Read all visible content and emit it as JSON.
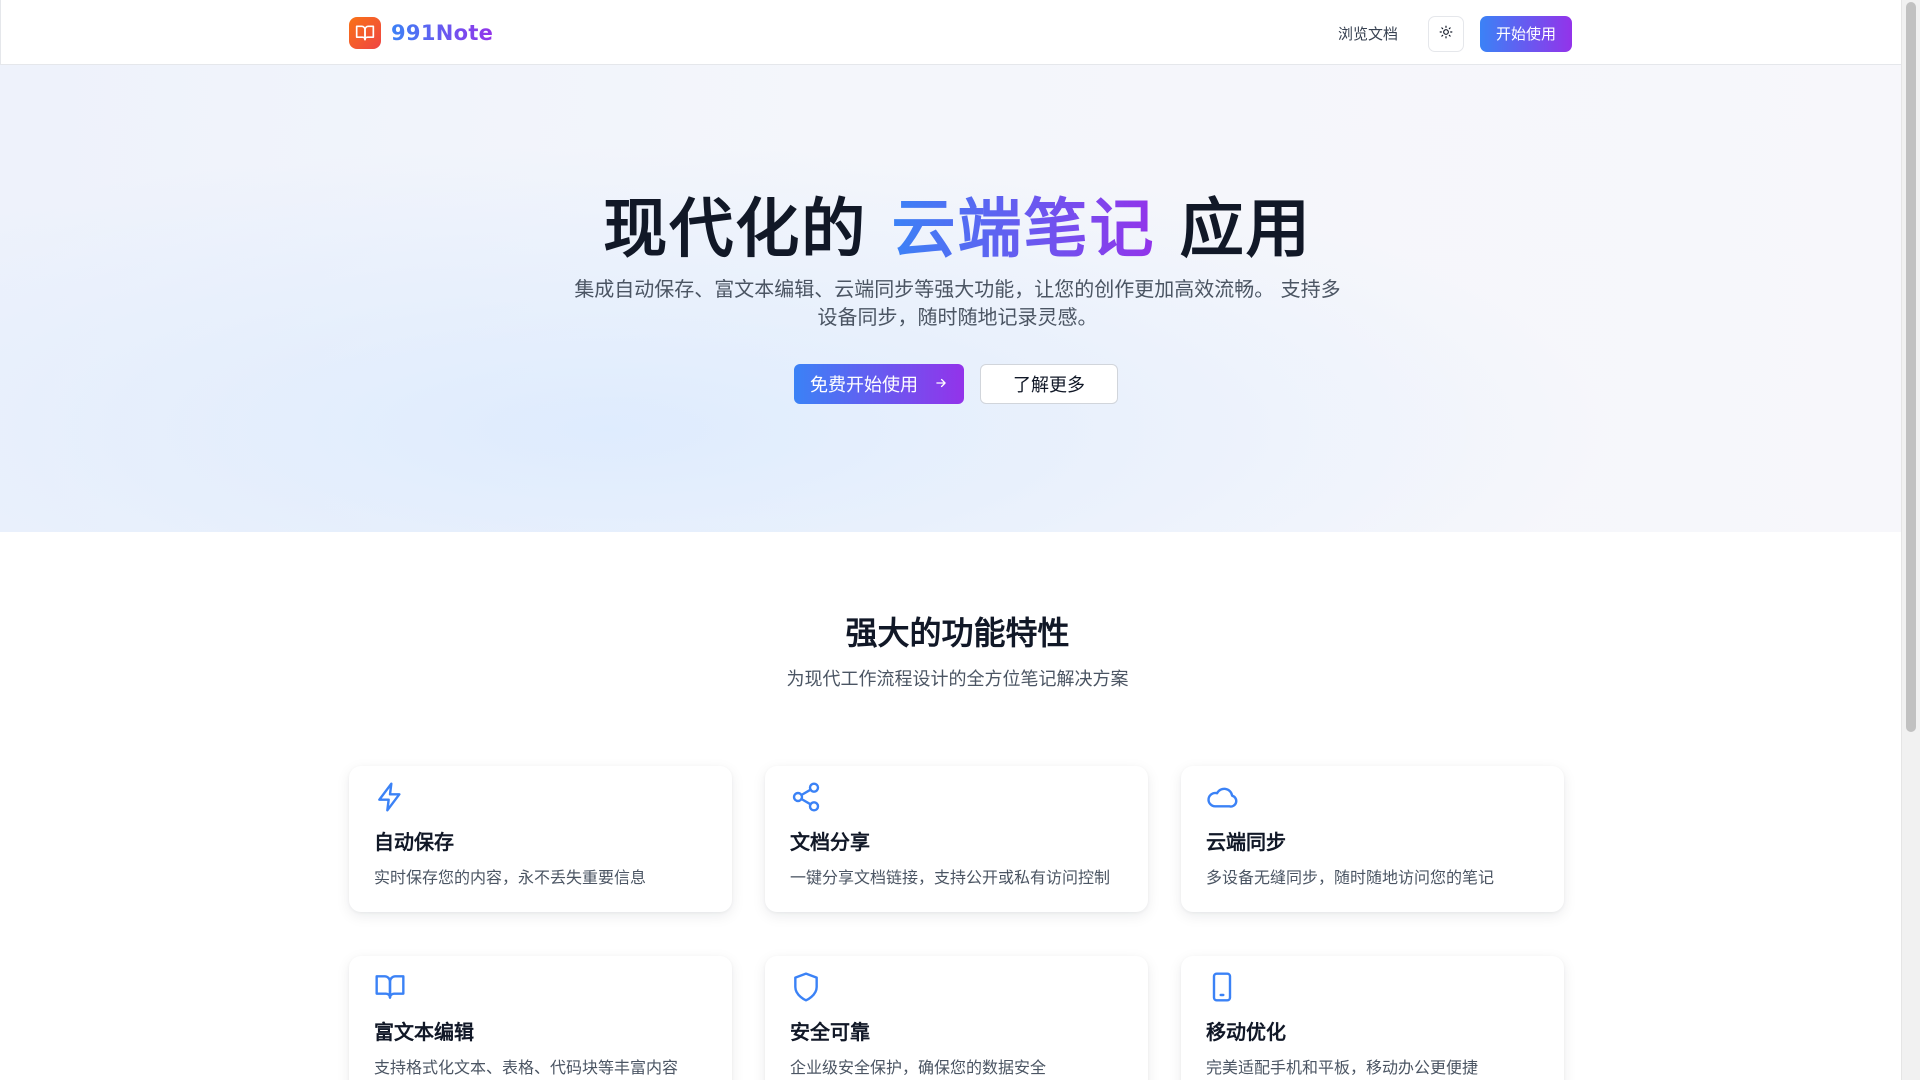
{
  "header": {
    "brand_name": "991Note",
    "logo_icon": "book-open-icon",
    "docs_link": "浏览文档",
    "theme_icon": "sun-icon",
    "start_label": "开始使用"
  },
  "hero": {
    "title_before": "现代化的",
    "title_highlight": "云端笔记",
    "title_after": "应用",
    "subtitle": "集成自动保存、富文本编辑、云端同步等强大功能，让您的创作更加高效流畅。 支持多设备同步，随时随地记录灵感。",
    "primary_button": "免费开始使用",
    "primary_button_icon": "arrow-right-icon",
    "secondary_button": "了解更多"
  },
  "features": {
    "title": "强大的功能特性",
    "subtitle": "为现代工作流程设计的全方位笔记解决方案",
    "items": [
      {
        "icon": "zap-icon",
        "title": "自动保存",
        "desc": "实时保存您的内容，永不丢失重要信息"
      },
      {
        "icon": "share-icon",
        "title": "文档分享",
        "desc": "一键分享文档链接，支持公开或私有访问控制"
      },
      {
        "icon": "cloud-icon",
        "title": "云端同步",
        "desc": "多设备无缝同步，随时随地访问您的笔记"
      },
      {
        "icon": "book-open-icon",
        "title": "富文本编辑",
        "desc": "支持格式化文本、表格、代码块等丰富内容"
      },
      {
        "icon": "shield-icon",
        "title": "安全可靠",
        "desc": "企业级安全保护，确保您的数据安全"
      },
      {
        "icon": "tablet-icon",
        "title": "移动优化",
        "desc": "完美适配手机和平板，移动办公更便捷"
      }
    ]
  },
  "colors": {
    "accent_start": "#3b82f6",
    "accent_end": "#9333ea",
    "icon_blue": "#3b82f6",
    "logo_orange": "#f97316"
  }
}
